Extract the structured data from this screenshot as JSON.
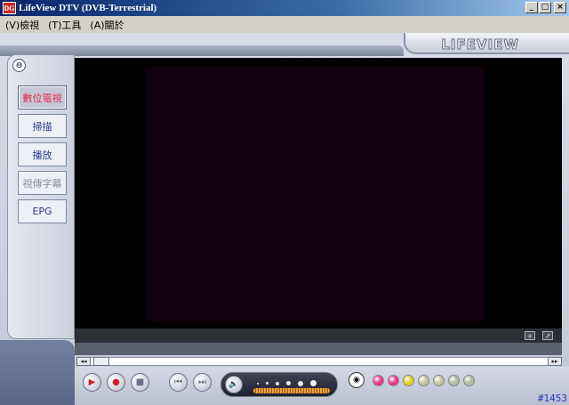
{
  "window": {
    "title": "LifeView DTV (DVB-Terrestrial)",
    "icon_text": "DG",
    "minimize": "_",
    "maximize": "□",
    "close": "×"
  },
  "menu": [
    {
      "label": "(V)檢視"
    },
    {
      "label": "(T)工具"
    },
    {
      "label": "(A)關於"
    }
  ],
  "brand": {
    "logo": "LIFEVIEW"
  },
  "nav": {
    "collapse_icon": "⊖",
    "items": [
      {
        "label": "數位電視",
        "state": "active"
      },
      {
        "label": "掃描",
        "state": "normal"
      },
      {
        "label": "播放",
        "state": "normal"
      },
      {
        "label": "視傳字幕",
        "state": "disabled"
      },
      {
        "label": "EPG",
        "state": "normal"
      }
    ]
  },
  "video": {
    "button_left": "+",
    "button_right": "↗"
  },
  "seek": {
    "left_arrow": "◂◂",
    "right_arrow": "▸▸"
  },
  "controls": {
    "play_icon": "▶",
    "record_icon": "●",
    "stop_icon": "■",
    "prev_icon": "⏮",
    "next_icon": "⏭",
    "volume_icon": "🔈",
    "snapshot_icon": "◉",
    "color_buttons": [
      "#e8388a",
      "#e8388a",
      "#e8d020",
      "#c8c4a0",
      "#c8c4a0",
      "#b0bca0",
      "#b0bca0"
    ],
    "channel": "#1453"
  }
}
